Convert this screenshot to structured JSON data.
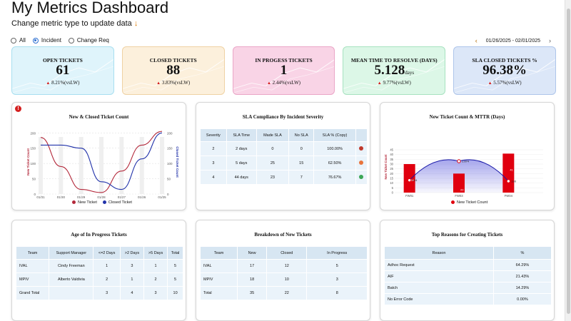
{
  "header": {
    "title": "My Metrics Dashboard",
    "subtitle": "Change metric type to update data",
    "subtitle_arrow": "↓"
  },
  "filters": {
    "options": [
      "All",
      "Incident",
      "Change Req"
    ],
    "selected": "Incident"
  },
  "date_range": {
    "label": "01/26/2025 - 02/01/2025",
    "prev": "‹",
    "next": "›"
  },
  "kpis": [
    {
      "label": "OPEN TICKETS",
      "value": "61",
      "unit": "",
      "delta": "8.21%(vsLW)",
      "bg": "#dff4fb",
      "border": "#a8dff0"
    },
    {
      "label": "CLOSED TICKETS",
      "value": "88",
      "unit": "",
      "delta": "3.83%(vsLW)",
      "bg": "#fcf0dc",
      "border": "#efd2a4"
    },
    {
      "label": "IN PROGESS TICKETS",
      "value": "1",
      "unit": "",
      "delta": "2.44%(vsLW)",
      "bg": "#f9d4e6",
      "border": "#eaa6c7"
    },
    {
      "label": "MEAN TIME TO RESOLVE (DAYS)",
      "value": "5.128",
      "unit": "days",
      "delta": "9.77%(vsLW)",
      "bg": "#dcf7e7",
      "border": "#a7e2c0"
    },
    {
      "label": "SLA CLOSED TICKETS %",
      "value": "96.38%",
      "unit": "",
      "delta": "5.57%(vsLW)",
      "bg": "#dce7f8",
      "border": "#aec5ea"
    }
  ],
  "new_closed_chart": {
    "title": "New & Closed Ticket Count",
    "ylabel_left": "New Ticket Count",
    "ylabel_right": "Closed Ticket Count",
    "legend": [
      "New Ticket",
      "Closed Ticket"
    ],
    "alert_icon": "!"
  },
  "sla_table": {
    "title": "SLA Compliance By Incident Severity",
    "headers": [
      "Severity",
      "SLA Time",
      "Made SLA",
      "No SLA",
      "SLA % (Copy)",
      ""
    ],
    "rows": [
      {
        "severity": "2",
        "sla_time": "2 days",
        "made": "0",
        "no": "0",
        "pct": "100.00%",
        "status": "x-circle-icon",
        "status_color": "#c0392b"
      },
      {
        "severity": "3",
        "sla_time": "5 days",
        "made": "25",
        "no": "15",
        "pct": "62.50%",
        "status": "warning-circle-icon",
        "status_color": "#e8743b"
      },
      {
        "severity": "4",
        "sla_time": "44 days",
        "made": "23",
        "no": "7",
        "pct": "76.67%",
        "status": "check-circle-icon",
        "status_color": "#3aa655"
      }
    ]
  },
  "mttr_chart": {
    "title": "New Ticket Count & MTTR (Days)",
    "ylabel": "New Ticket Count",
    "legend": "New Ticket Count"
  },
  "age_table": {
    "title": "Age of In Progress Tickets",
    "headers": [
      "Team",
      "Support Manager",
      "<=2 Days",
      ">2 Days",
      ">5 Days",
      "Total"
    ],
    "rows": [
      [
        "IVAL",
        "Cindy Freeman",
        "1",
        "3",
        "1",
        "5"
      ],
      [
        "MPIV",
        "Alberto Valdivia",
        "2",
        "1",
        "2",
        "5"
      ],
      [
        "Grand Total",
        "",
        "3",
        "4",
        "3",
        "10"
      ]
    ]
  },
  "breakdown_table": {
    "title": "Breakdown of New Tickets",
    "headers": [
      "Team",
      "New",
      "Closed",
      "In Progress"
    ],
    "rows": [
      [
        "IVAL",
        "17",
        "12",
        "5"
      ],
      [
        "MPIV",
        "18",
        "10",
        "3"
      ],
      [
        "Total",
        "35",
        "22",
        "8"
      ]
    ]
  },
  "reasons_table": {
    "title": "Top Reasons for Creating Tickets",
    "headers": [
      "Reason",
      "%"
    ],
    "rows": [
      [
        "Adhoc Request",
        "64.29%"
      ],
      [
        "AIF",
        "21.43%"
      ],
      [
        "Batch",
        "14.29%"
      ],
      [
        "No Error Code",
        "0.00%"
      ]
    ]
  },
  "chart_data": [
    {
      "type": "line",
      "title": "New & Closed Ticket Count",
      "x": [
        "01/31",
        "01/30",
        "01/29",
        "01/28",
        "01/27",
        "01/26",
        "01/25"
      ],
      "series": [
        {
          "name": "New Ticket",
          "color": "#b3283a",
          "values": [
            185,
            90,
            15,
            5,
            75,
            160,
            205
          ]
        },
        {
          "name": "Closed Ticket",
          "color": "#2233aa",
          "values": [
            160,
            160,
            150,
            40,
            15,
            115,
            200
          ]
        }
      ],
      "ylabel_left": "New Ticket Count",
      "ylabel_right": "Closed Ticket Count",
      "yticks_left": [
        "0",
        "50",
        "100",
        "150",
        "200"
      ],
      "yticks_right": [
        "0",
        "50",
        "100",
        "150",
        "200"
      ],
      "ylim": [
        0,
        210
      ]
    },
    {
      "type": "bar",
      "title": "New Ticket Count & MTTR (Days)",
      "categories": [
        "FW01",
        "FW03",
        "FW04"
      ],
      "values": [
        30,
        20,
        41
      ],
      "line_labels": [
        "124",
        "1.874",
        "190"
      ],
      "line_values": [
        13,
        33,
        12
      ],
      "ylabel": "New Ticket Count",
      "yticks": [
        "0",
        "5",
        "10",
        "15",
        "20",
        "25",
        "30",
        "35",
        "40",
        "45"
      ],
      "ylim": [
        0,
        45
      ],
      "bar_color": "#e0000f",
      "line_color": "#1a1aa8"
    }
  ]
}
